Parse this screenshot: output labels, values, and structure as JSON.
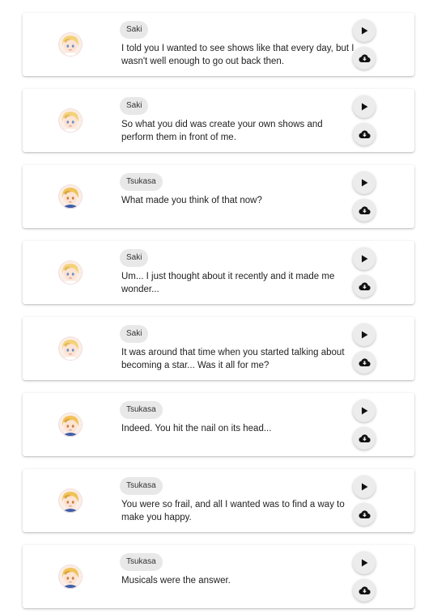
{
  "icons": {
    "play": "play-icon",
    "download": "cloud-download-icon"
  },
  "messages": [
    {
      "speaker": "Saki",
      "text": "I told you I wanted to see shows like that every day, but I wasn't well enough to go out back then.",
      "avatar": "saki"
    },
    {
      "speaker": "Saki",
      "text": "So what you did was create your own shows and perform them in front of me.",
      "avatar": "saki"
    },
    {
      "speaker": "Tsukasa",
      "text": "What made you think of that now?",
      "avatar": "tsukasa"
    },
    {
      "speaker": "Saki",
      "text": "Um... I just thought about it recently and it made me wonder...",
      "avatar": "saki"
    },
    {
      "speaker": "Saki",
      "text": "It was around that time when you started talking about becoming a star... Was it all for me?",
      "avatar": "saki"
    },
    {
      "speaker": "Tsukasa",
      "text": "Indeed. You hit the nail on its head...",
      "avatar": "tsukasa"
    },
    {
      "speaker": "Tsukasa",
      "text": "You were so frail, and all I wanted was to find a way to make you happy.",
      "avatar": "tsukasa"
    },
    {
      "speaker": "Tsukasa",
      "text": "Musicals were the answer.",
      "avatar": "tsukasa"
    }
  ]
}
